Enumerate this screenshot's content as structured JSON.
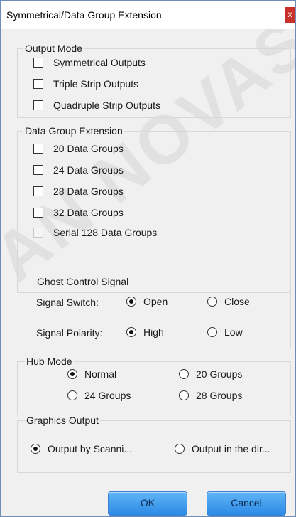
{
  "window": {
    "title": "Symmetrical/Data Group Extension",
    "close_glyph": "x",
    "watermark": "AN NOVASTAR"
  },
  "output_mode": {
    "legend": "Output Mode",
    "options": [
      {
        "label": "Symmetrical Outputs",
        "checked": false
      },
      {
        "label": "Triple Strip Outputs",
        "checked": false
      },
      {
        "label": "Quadruple Strip Outputs",
        "checked": false
      }
    ]
  },
  "data_group_extension": {
    "legend": "Data Group Extension",
    "options": [
      {
        "label": "20 Data Groups",
        "checked": false
      },
      {
        "label": "24 Data Groups",
        "checked": false
      },
      {
        "label": "28 Data Groups",
        "checked": false
      },
      {
        "label": "32 Data Groups",
        "checked": false
      },
      {
        "label": "Serial 128 Data Groups",
        "checked": false,
        "disabled": true
      }
    ]
  },
  "ghost_control": {
    "legend": "Ghost Control Signal",
    "signal_switch_label": "Signal Switch:",
    "signal_switch_options": [
      {
        "label": "Open",
        "selected": true
      },
      {
        "label": "Close",
        "selected": false
      }
    ],
    "signal_polarity_label": "Signal Polarity:",
    "signal_polarity_options": [
      {
        "label": "High",
        "selected": true
      },
      {
        "label": "Low",
        "selected": false
      }
    ]
  },
  "hub_mode": {
    "legend": "Hub Mode",
    "options": [
      {
        "label": "Normal",
        "selected": true
      },
      {
        "label": "20 Groups",
        "selected": false
      },
      {
        "label": "24 Groups",
        "selected": false
      },
      {
        "label": "28 Groups",
        "selected": false
      }
    ]
  },
  "graphics_output": {
    "legend": "Graphics Output",
    "options": [
      {
        "label": "Output by Scanni...",
        "selected": true
      },
      {
        "label": "Output in the dir...",
        "selected": false
      }
    ]
  },
  "buttons": {
    "ok": "OK",
    "cancel": "Cancel"
  },
  "colors": {
    "button_gradient_top": "#5fb5f5",
    "button_gradient_bottom": "#2d8ae6",
    "close_button": "#c8312a"
  }
}
